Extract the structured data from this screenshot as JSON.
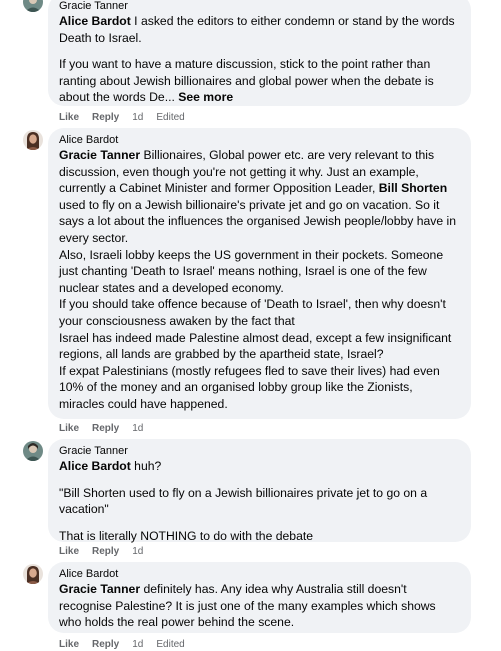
{
  "comments": [
    {
      "author": "Gracie Tanner",
      "paragraphs": [
        [
          {
            "t": "Alice Bardot",
            "m": true
          },
          {
            "t": " I asked the editors to either condemn or stand by the words Death to Israel."
          }
        ],
        [
          {
            "t": "If you want to have a mature discussion, stick to the point rather than ranting about Jewish billionaires and global power when the debate is about the words De... "
          },
          {
            "t": "See more",
            "s": true
          }
        ]
      ],
      "like": "Like",
      "reply": "Reply",
      "time": "1d",
      "edited": "Edited"
    },
    {
      "author": "Alice Bardot",
      "paragraphs": [
        [
          {
            "t": "Gracie Tanner",
            "m": true
          },
          {
            "t": " Billionaires, Global power etc. are very relevant to this discussion, even though you're not getting it why. Just an example, currently a Cabinet Minister and former Opposition Leader, "
          },
          {
            "t": "Bill Shorten",
            "m": true
          },
          {
            "t": " used to fly on a Jewish billionaire's private jet and go on vacation. So it says a lot about the influences the organised Jewish people/lobby have in every sector."
          }
        ],
        [
          {
            "t": "Also, Israeli lobby keeps the US government in their pockets. Someone just chanting 'Death to Israel' means nothing, Israel is one of the few nuclear states and a developed economy."
          }
        ],
        [
          {
            "t": "If you should take offence because of 'Death to Israel', then why doesn't your consciousness awaken by the fact that"
          }
        ],
        [
          {
            "t": "Israel has indeed made Palestine almost dead, except a few insignificant regions, all lands are grabbed by the apartheid state, Israel?"
          }
        ],
        [
          {
            "t": "If expat Palestinians (mostly refugees fled to save their lives) had even 10% of the money and an organised lobby group like the Zionists, miracles could have happened."
          }
        ]
      ],
      "like": "Like",
      "reply": "Reply",
      "time": "1d",
      "edited": ""
    },
    {
      "author": "Gracie Tanner",
      "paragraphs": [
        [
          {
            "t": "Alice Bardot",
            "m": true
          },
          {
            "t": " huh?"
          }
        ],
        [
          {
            "t": "\"Bill Shorten used to fly on a Jewish billionaires private jet to go on a vacation\""
          }
        ],
        [
          {
            "t": "That is literally NOTHING to do with the debate"
          }
        ]
      ],
      "like": "Like",
      "reply": "Reply",
      "time": "1d",
      "edited": ""
    },
    {
      "author": "Alice Bardot",
      "paragraphs": [
        [
          {
            "t": "Gracie Tanner",
            "m": true
          },
          {
            "t": " definitely has. Any idea why Australia still doesn't recognise Palestine? It is just one of the many examples which shows who holds the real power behind the scene."
          }
        ]
      ],
      "like": "Like",
      "reply": "Reply",
      "time": "1d",
      "edited": "Edited"
    }
  ]
}
